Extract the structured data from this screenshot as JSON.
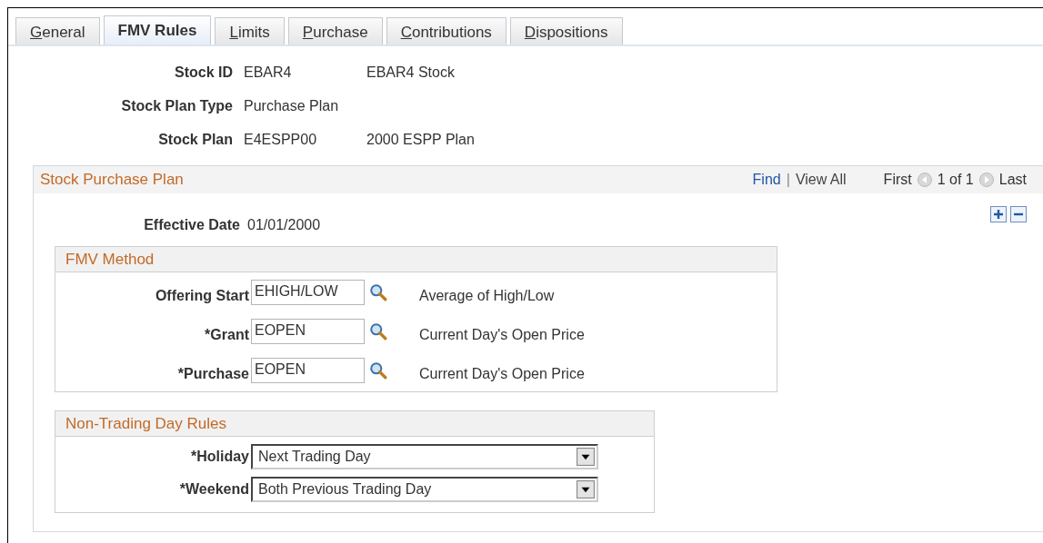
{
  "tabs": [
    {
      "label": "General",
      "selected": false
    },
    {
      "label": "FMV Rules",
      "selected": true
    },
    {
      "label": "Limits",
      "selected": false
    },
    {
      "label": "Purchase",
      "selected": false
    },
    {
      "label": "Contributions",
      "selected": false
    },
    {
      "label": "Dispositions",
      "selected": false
    }
  ],
  "header_fields": [
    {
      "label": "Stock ID",
      "value": "EBAR4",
      "description": "EBAR4 Stock"
    },
    {
      "label": "Stock Plan Type",
      "value": "Purchase Plan"
    },
    {
      "label": "Stock Plan",
      "value": "E4ESPP00",
      "description": "2000 ESPP Plan"
    }
  ],
  "section": {
    "title": "Stock Purchase Plan",
    "find": "Find",
    "separator": "|",
    "view_all": "View All",
    "first": "First",
    "count": "1 of 1",
    "last": "Last",
    "effective_date": {
      "label": "Effective Date",
      "value": "01/01/2000"
    },
    "fmv_method": {
      "title": "FMV Method",
      "rows": [
        {
          "label": "Offering Start",
          "value": "EHIGH/LOW",
          "description": "Average of High/Low"
        },
        {
          "label": "*Grant",
          "value": "EOPEN",
          "description": "Current Day's Open Price"
        },
        {
          "label": "*Purchase",
          "value": "EOPEN",
          "description": "Current Day's Open Price"
        }
      ]
    },
    "non_trading_day_rules": {
      "title": "Non-Trading Day Rules",
      "rows": [
        {
          "label": "*Holiday",
          "value": "Next Trading Day"
        },
        {
          "label": "*Weekend",
          "value": "Both Previous Trading Day"
        }
      ]
    }
  }
}
